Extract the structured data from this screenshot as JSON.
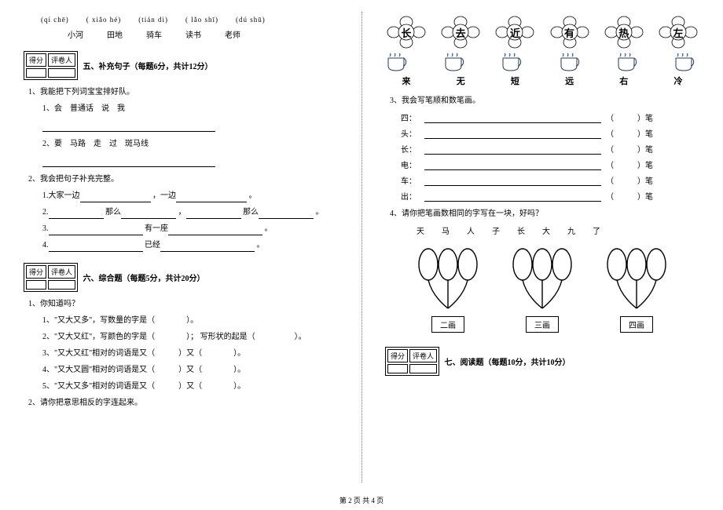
{
  "footer": "第 2 页 共 4 页",
  "left": {
    "pinyin": [
      "(qí chē)",
      "( xiǎo hé)",
      "(tián dì)",
      "( lǎo shī)",
      "(dú shū)"
    ],
    "words": [
      "小河",
      "田地",
      "骑车",
      "读书",
      "老师"
    ],
    "score": {
      "c1": "得分",
      "c2": "评卷人"
    },
    "s5": {
      "title": "五、补充句子（每题6分，共计12分）",
      "q1_intro": "1、我能把下列词宝宝排好队。",
      "q1_1": "1、会　普通话　说　我",
      "q1_2": "2、要　马路　走　过　斑马线",
      "q2_intro": "2、我会把句子补充完整。",
      "q2_1_a": "1.大家一边",
      "q2_1_b": "，一边",
      "q2_1_c": "。",
      "q2_2_a": "2.",
      "q2_2_b": "那么",
      "q2_2_c": "，",
      "q2_2_d": "那么",
      "q2_2_e": "。",
      "q2_3_a": "3.",
      "q2_3_b": "有一座",
      "q2_3_c": "。",
      "q2_4_a": "4.",
      "q2_4_b": "已经",
      "q2_4_c": "。"
    },
    "s6": {
      "title": "六、综合题（每题5分，共计20分）",
      "q1_intro": "1、你知道吗？",
      "q1_1": "1、\"又大又多\"，写数量的字是（　　　　）。",
      "q1_2a": "2、\"又大又红\"，写颜色的字是（　　　　）；",
      "q1_2b": "写形状的起是（　　　　　）。",
      "q1_3": "3、\"又大又红\"相对的词语是又（　　　）又（　　　　）。",
      "q1_4": "4、\"又大又圆\"相对的词语是又（　　　）又（　　　　）。",
      "q1_5": "5、\"又大又多\"相对的词语是又（　　　）又（　　　　）。",
      "q2": "2、请你把意思相反的字连起来。"
    }
  },
  "right": {
    "flowers": [
      "长",
      "去",
      "近",
      "有",
      "热",
      "左"
    ],
    "bottom_labels": [
      "来",
      "无",
      "短",
      "远",
      "右",
      "冷"
    ],
    "q3_intro": "3、我会写笔顺和数笔画。",
    "stroke_chars": [
      "四：",
      "头：",
      "长：",
      "电：",
      "车：",
      "出："
    ],
    "stroke_tail_a": "（",
    "stroke_tail_b": "）笔",
    "q4_intro": "4、请你把笔画数相同的字写在一块，好吗？",
    "q4_chars": [
      "天",
      "马",
      "人",
      "子",
      "长",
      "大",
      "九",
      "了"
    ],
    "balloon_labels": [
      "二画",
      "三画",
      "四画"
    ],
    "score": {
      "c1": "得分",
      "c2": "评卷人"
    },
    "s7": {
      "title": "七、阅读题（每题10分，共计10分）"
    }
  }
}
